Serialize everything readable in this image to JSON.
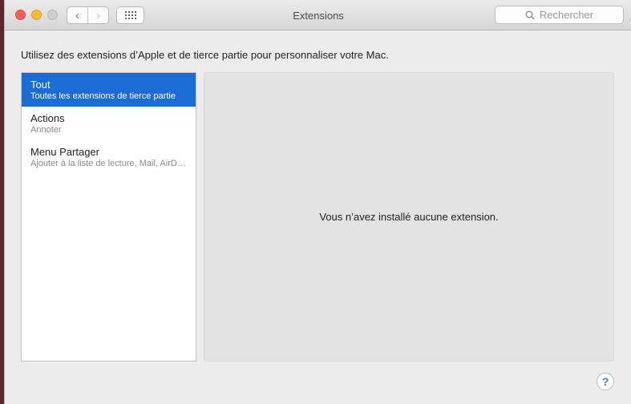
{
  "window": {
    "title": "Extensions"
  },
  "toolbar": {
    "back_glyph": "‹",
    "forward_glyph": "›",
    "search_placeholder": "Rechercher"
  },
  "intro": "Utilisez des extensions d’Apple et de tierce partie pour personnaliser votre Mac.",
  "sidebar": {
    "items": [
      {
        "name": "Tout",
        "sub": "Toutes les extensions de tierce partie",
        "selected": true
      },
      {
        "name": "Actions",
        "sub": "Annoter",
        "selected": false
      },
      {
        "name": "Menu Partager",
        "sub": "Ajouter à la liste de lecture, Mail, AirDrop, Messages, Notes, Rappels",
        "selected": false
      }
    ]
  },
  "detail": {
    "empty_message": "Vous n’avez installé aucune extension."
  },
  "help": {
    "label": "?"
  },
  "colors": {
    "selection": "#1b6dd5",
    "close": "#fc5f57",
    "minimize": "#fdbc2e"
  }
}
